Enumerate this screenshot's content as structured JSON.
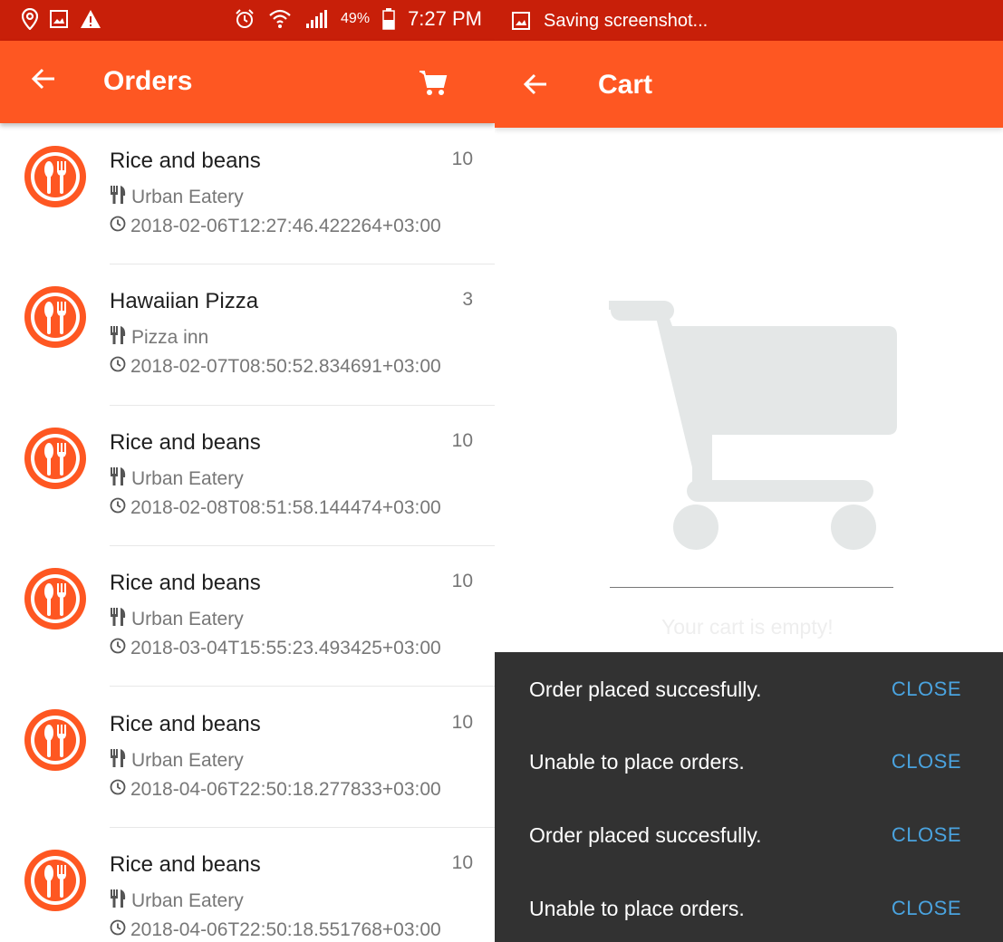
{
  "status_bar": {
    "battery": "49%",
    "time": "7:27 PM",
    "icons": [
      "location-icon",
      "image-icon",
      "warning-icon",
      "alarm-icon",
      "wifi-icon",
      "signal-icon",
      "battery-icon"
    ]
  },
  "saving": {
    "text": "Saving screenshot...",
    "icon": "image-icon"
  },
  "orders_screen": {
    "title": "Orders",
    "back_icon": "arrow-left-icon",
    "cart_icon": "cart-icon",
    "orders": [
      {
        "name": "Rice and beans",
        "quantity": "10",
        "restaurant": "Urban Eatery",
        "timestamp": "2018-02-06T12:27:46.422264+03:00"
      },
      {
        "name": "Hawaiian Pizza",
        "quantity": "3",
        "restaurant": "Pizza inn",
        "timestamp": "2018-02-07T08:50:52.834691+03:00"
      },
      {
        "name": "Rice and beans",
        "quantity": "10",
        "restaurant": "Urban Eatery",
        "timestamp": "2018-02-08T08:51:58.144474+03:00"
      },
      {
        "name": "Rice and beans",
        "quantity": "10",
        "restaurant": "Urban Eatery",
        "timestamp": "2018-03-04T15:55:23.493425+03:00"
      },
      {
        "name": "Rice and beans",
        "quantity": "10",
        "restaurant": "Urban Eatery",
        "timestamp": "2018-04-06T22:50:18.277833+03:00"
      },
      {
        "name": "Rice and beans",
        "quantity": "10",
        "restaurant": "Urban Eatery",
        "timestamp": "2018-04-06T22:50:18.551768+03:00"
      }
    ]
  },
  "cart_screen": {
    "title": "Cart",
    "back_icon": "arrow-left-icon",
    "empty_text": "Your cart is empty!",
    "empty_icon": "cart-icon"
  },
  "snackbars": [
    {
      "message": "Order placed succesfully.",
      "action": "CLOSE"
    },
    {
      "message": "Unable to place orders.",
      "action": "CLOSE"
    },
    {
      "message": "Order placed succesfully.",
      "action": "CLOSE"
    },
    {
      "message": "Unable to place orders.",
      "action": "CLOSE"
    }
  ],
  "colors": {
    "status_bar": "#c81f09",
    "app_bar": "#fe5722",
    "snackbar_bg": "#323232",
    "snackbar_action": "#4aa3df",
    "secondary_text": "#777777"
  }
}
